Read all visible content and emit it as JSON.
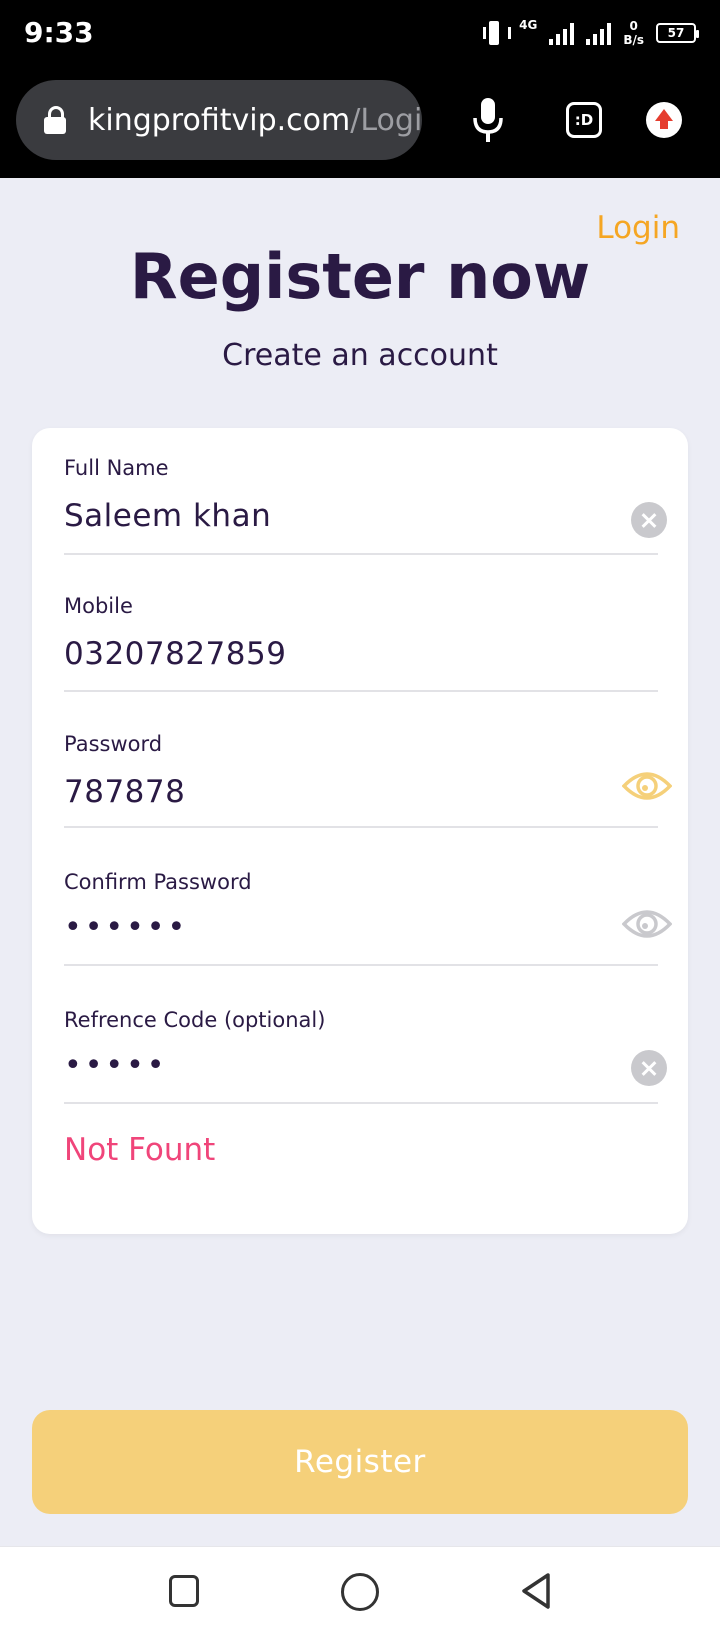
{
  "status_bar": {
    "time": "9:33",
    "network_type": "4G",
    "speed_value": "0",
    "speed_unit": "B/s",
    "battery": "57"
  },
  "browser": {
    "url_domain": "kingprofitvip.com",
    "url_path": "/Logi",
    "tabs_label": ":D",
    "icons": [
      "lock-icon",
      "microphone-icon",
      "tabs-icon",
      "update-icon"
    ]
  },
  "page": {
    "login_link": "Login",
    "title": "Register now",
    "subtitle": "Create an account"
  },
  "form": {
    "full_name": {
      "label": "Full Name",
      "value": "Saleem khan"
    },
    "mobile": {
      "label": "Mobile",
      "value": "03207827859"
    },
    "password": {
      "label": "Password",
      "value": "787878"
    },
    "confirm_password": {
      "label": "Confirm Password",
      "value": "••••••"
    },
    "reference_code": {
      "label": "Refrence Code (optional)",
      "value": "•••••"
    },
    "error": "Not Fount"
  },
  "register_button": "Register",
  "colors": {
    "accent": "#f5a623",
    "button_disabled": "#f5d07a",
    "error": "#f0457a",
    "text": "#2a1a44",
    "background": "#ecedf5"
  },
  "nav": {
    "icons": [
      "recent-apps-icon",
      "home-icon",
      "back-icon"
    ]
  }
}
